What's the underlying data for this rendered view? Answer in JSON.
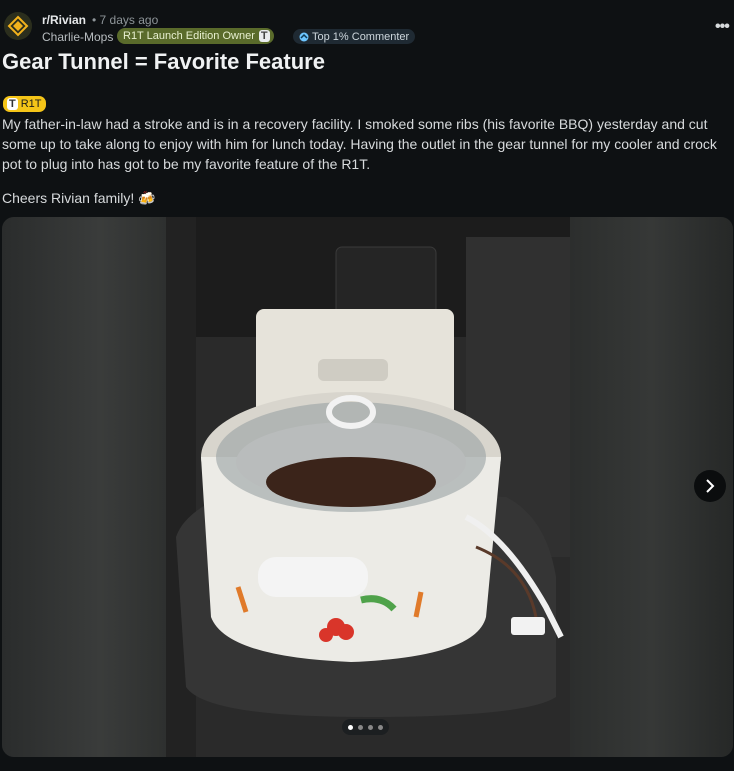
{
  "post": {
    "subreddit": "r/Rivian",
    "time_ago": "• 7 days ago",
    "username": "Charlie-Mops",
    "user_flair": "R1T Launch Edition Owner",
    "commenter_badge": "Top 1% Commenter",
    "more_label": "•••",
    "title": "Gear Tunnel = Favorite Feature",
    "post_flair": "R1T",
    "body_text": "My father-in-law had a stroke and is in a recovery facility. I smoked some ribs (his favorite BBQ) yesterday and cut some up to take along to enjoy with him for lunch today. Having the outlet in the gear tunnel for my cooler and crock pot to plug into has got to be my favorite feature of the R1T.",
    "cheers_text": "Cheers Rivian family! 🍻"
  },
  "gallery": {
    "current_index": 1,
    "total": 4,
    "next_icon": "chevron-right-icon"
  },
  "colors": {
    "background": "#0e1113",
    "owner_flair": "#5a6b2b",
    "post_flair": "#f5c518"
  }
}
